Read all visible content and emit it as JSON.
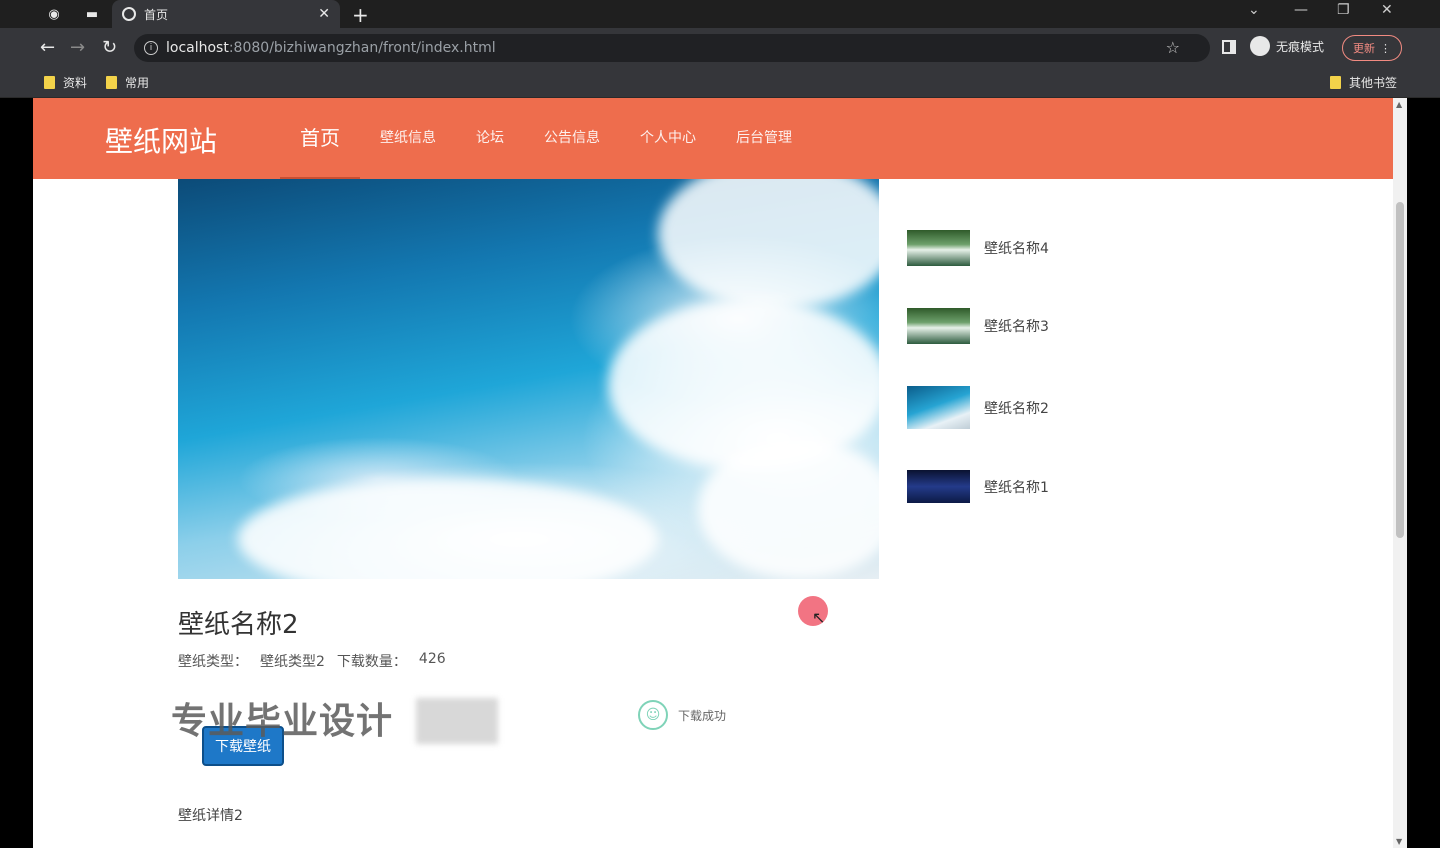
{
  "browser": {
    "tab_title": "首页",
    "url_host": "localhost",
    "url_path": ":8080/bizhiwangzhan/front/index.html",
    "incognito_label": "无痕模式",
    "update_label": "更新",
    "bookmarks": [
      "资料",
      "常用"
    ],
    "other_bookmarks": "其他书签"
  },
  "site": {
    "logo": "壁纸网站",
    "nav": [
      "首页",
      "壁纸信息",
      "论坛",
      "公告信息",
      "个人中心",
      "后台管理"
    ],
    "active_nav": "首页"
  },
  "sidebar": {
    "items": [
      {
        "name": "壁纸名称4",
        "thumb": "waterfall"
      },
      {
        "name": "壁纸名称3",
        "thumb": "waterfall"
      },
      {
        "name": "壁纸名称2",
        "thumb": "sky"
      },
      {
        "name": "壁纸名称1",
        "thumb": "night"
      }
    ]
  },
  "detail": {
    "title": "壁纸名称2",
    "type_label": "壁纸类型：",
    "type_value": "壁纸类型2",
    "downloads_label": "下载数量：",
    "downloads_value": "426",
    "download_button": "下载壁纸",
    "toast": "下载成功",
    "description": "壁纸详情2",
    "watermark": "专业毕业设计"
  },
  "colors": {
    "header": "#ee6d4d",
    "button": "#1e78c8"
  }
}
